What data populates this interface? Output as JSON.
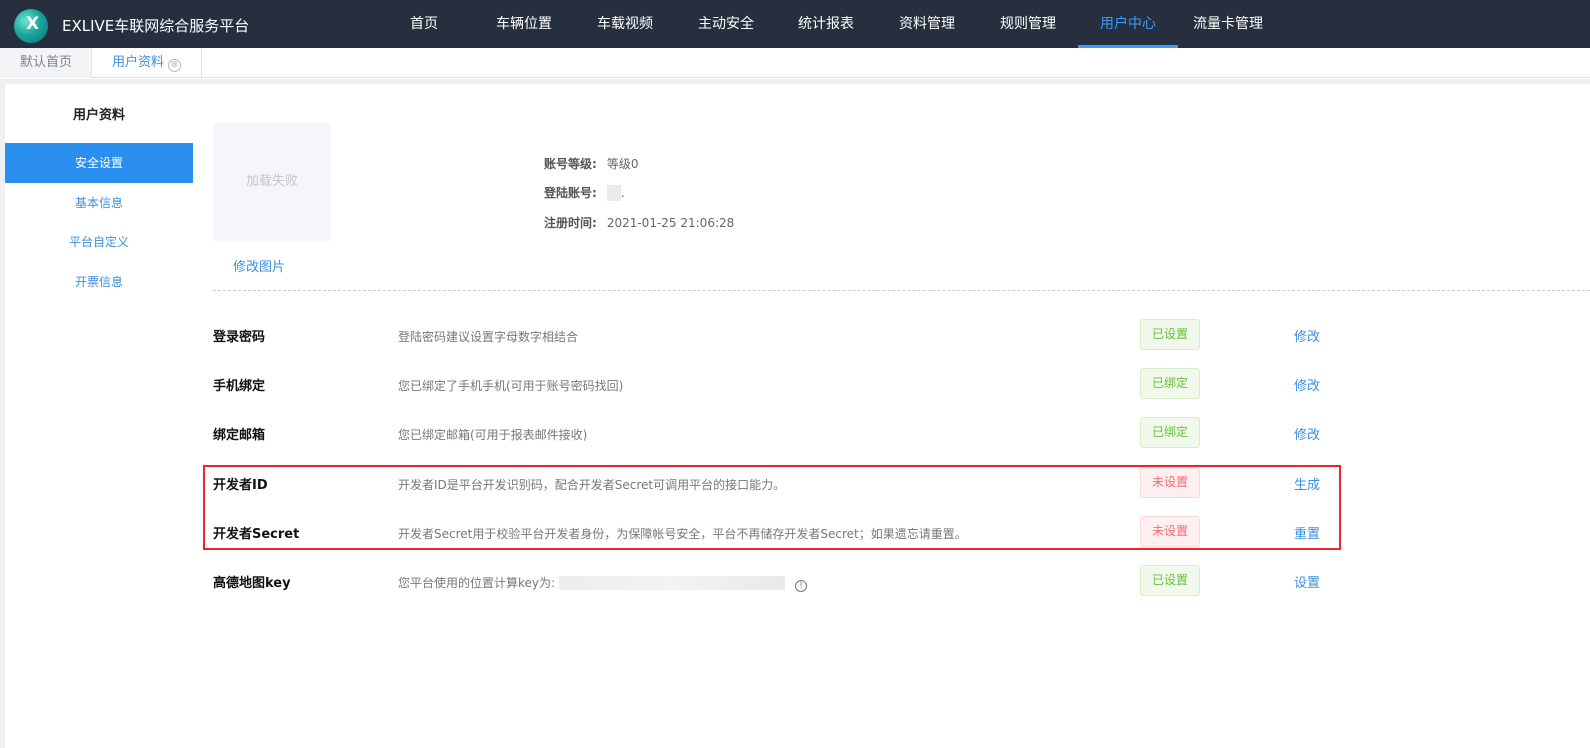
{
  "header": {
    "logo_icon": "x-circle-logo",
    "logo_letter": "X",
    "app_title": "EXLIVE车联网综合服务平台",
    "nav": [
      {
        "label": "首页",
        "active": false
      },
      {
        "label": "车辆位置",
        "active": false
      },
      {
        "label": "车载视频",
        "active": false
      },
      {
        "label": "主动安全",
        "active": false
      },
      {
        "label": "统计报表",
        "active": false
      },
      {
        "label": "资料管理",
        "active": false
      },
      {
        "label": "规则管理",
        "active": false
      },
      {
        "label": "用户中心",
        "active": true
      },
      {
        "label": "流量卡管理",
        "active": false
      }
    ]
  },
  "tabs": [
    {
      "label": "默认首页"
    },
    {
      "label": "用户资料",
      "close_icon": "⊗"
    }
  ],
  "sidebar": {
    "title": "用户资料",
    "items": [
      {
        "label": "安全设置",
        "active": true
      },
      {
        "label": "基本信息"
      },
      {
        "label": "平台自定义"
      },
      {
        "label": "开票信息"
      }
    ]
  },
  "profile": {
    "avatar_text": "加载失败",
    "change_pic": "修改图片",
    "account_level_label": "账号等级:",
    "account_level": "等级0",
    "login_account_label": "登陆账号:",
    "login_account_suffix": ".",
    "register_time_label": "注册时间:",
    "register_time": "2021-01-25 21:06:28"
  },
  "security": {
    "rows": [
      {
        "title": "登录密码",
        "desc": "登陆密码建议设置字母数字相结合",
        "status": "已设置",
        "status_type": "ok",
        "action": "修改"
      },
      {
        "title": "手机绑定",
        "desc": "您已绑定了手机手机(可用于账号密码找回)",
        "status": "已绑定",
        "status_type": "ok",
        "action": "修改"
      },
      {
        "title": "绑定邮箱",
        "desc": "您已绑定邮箱(可用于报表邮件接收)",
        "status": "已绑定",
        "status_type": "ok",
        "action": "修改"
      },
      {
        "title": "开发者ID",
        "desc": "开发者ID是平台开发识别码，配合开发者Secret可调用平台的接口能力。",
        "status": "未设置",
        "status_type": "no",
        "action": "生成"
      },
      {
        "title": "开发者Secret",
        "desc": "开发者Secret用于校验平台开发者身份，为保障帐号安全，平台不再储存开发者Secret；如果遗忘请重置。",
        "status": "未设置",
        "status_type": "no",
        "action": "重置"
      },
      {
        "title": "高德地图key",
        "desc": "您平台使用的位置计算key为:",
        "status": "已设置",
        "status_type": "ok",
        "action": "设置",
        "info_icon": "!"
      }
    ]
  },
  "colors": {
    "topbar": "#262f3e",
    "accent": "#2b8ff0",
    "highlight_box": "#e8262b",
    "ok": "#67c23a",
    "warn": "#f56c6c"
  }
}
